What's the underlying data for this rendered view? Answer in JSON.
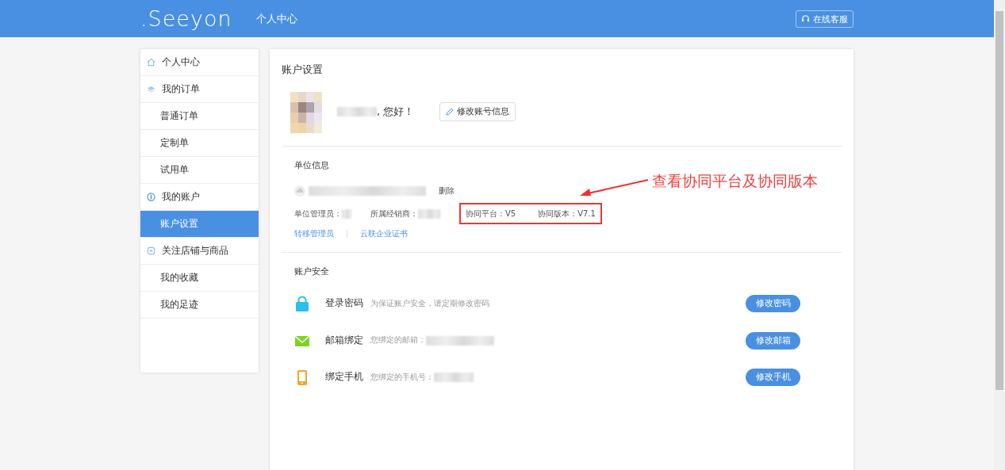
{
  "header": {
    "logo": ".Seeyon",
    "title": "个人中心",
    "service_button": "在线客服"
  },
  "sidebar": {
    "items": [
      {
        "label": "个人中心",
        "kind": "group",
        "selected": false
      },
      {
        "label": "我的订单",
        "kind": "group",
        "selected": false
      },
      {
        "label": "普通订单",
        "kind": "sub",
        "selected": false
      },
      {
        "label": "定制单",
        "kind": "sub",
        "selected": false
      },
      {
        "label": "试用单",
        "kind": "sub",
        "selected": false
      },
      {
        "label": "我的账户",
        "kind": "group",
        "selected": false
      },
      {
        "label": "账户设置",
        "kind": "sub",
        "selected": true
      },
      {
        "label": "关注店铺与商品",
        "kind": "group",
        "selected": false
      },
      {
        "label": "我的收藏",
        "kind": "sub",
        "selected": false
      },
      {
        "label": "我的足迹",
        "kind": "sub",
        "selected": false
      }
    ]
  },
  "main": {
    "title": "账户设置",
    "profile": {
      "greeting": ", 您好！",
      "edit_button": "修改账号信息"
    },
    "unit": {
      "heading": "单位信息",
      "delete_link": "删除",
      "admin_label": "单位管理员：",
      "dealer_label": "所属经销商：",
      "platform": "协同平台：V5",
      "version": "协同版本：V7.1",
      "links": [
        "转移管理员",
        "云联企业证书"
      ]
    },
    "security": {
      "heading": "账户安全",
      "rows": [
        {
          "label": "登录密码",
          "description": "为保证账户安全，请定期修改密码",
          "button": "修改密码"
        },
        {
          "label": "邮箱绑定",
          "description": "您绑定的邮箱：",
          "button": "修改邮箱"
        },
        {
          "label": "绑定手机",
          "description": "您绑定的手机号：",
          "button": "修改手机"
        }
      ]
    }
  },
  "annotation": {
    "text": "查看协同平台及协同版本"
  }
}
